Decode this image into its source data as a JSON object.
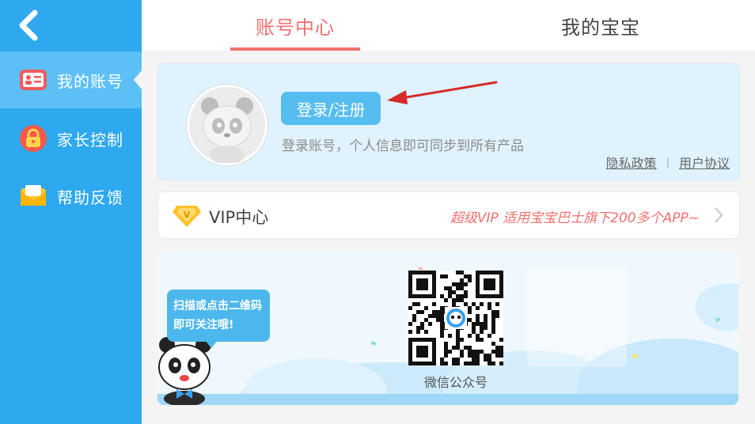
{
  "sidebar": {
    "back_icon": "chevron-left-icon",
    "items": [
      {
        "label": "我的账号",
        "icon": "id-card-icon",
        "active": true
      },
      {
        "label": "家长控制",
        "icon": "lock-icon",
        "active": false
      },
      {
        "label": "帮助反馈",
        "icon": "mail-icon",
        "active": false
      }
    ]
  },
  "tabs": [
    {
      "label": "账号中心",
      "active": true
    },
    {
      "label": "我的宝宝",
      "active": false
    }
  ],
  "profile": {
    "avatar_icon": "panda-avatar-icon",
    "login_button": "登录/注册",
    "subtitle": "登录账号，个人信息即可同步到所有产品",
    "privacy_link": "隐私政策",
    "separator": "|",
    "agreement_link": "用户协议"
  },
  "vip": {
    "title": "VIP中心",
    "promo": "超级VIP 适用宝宝巴士旗下200多个APP~",
    "icon": "vip-diamond-icon"
  },
  "qr": {
    "bubble_line1": "扫描或点击二维码",
    "bubble_line2": "即可关注哦!",
    "label": "微信公众号"
  },
  "colors": {
    "sidebar": "#2ea8ee",
    "sidebar_active": "#5cc0f6",
    "accent": "#f2706f",
    "button": "#55bdf0",
    "annotation_arrow": "#d62a2a"
  }
}
